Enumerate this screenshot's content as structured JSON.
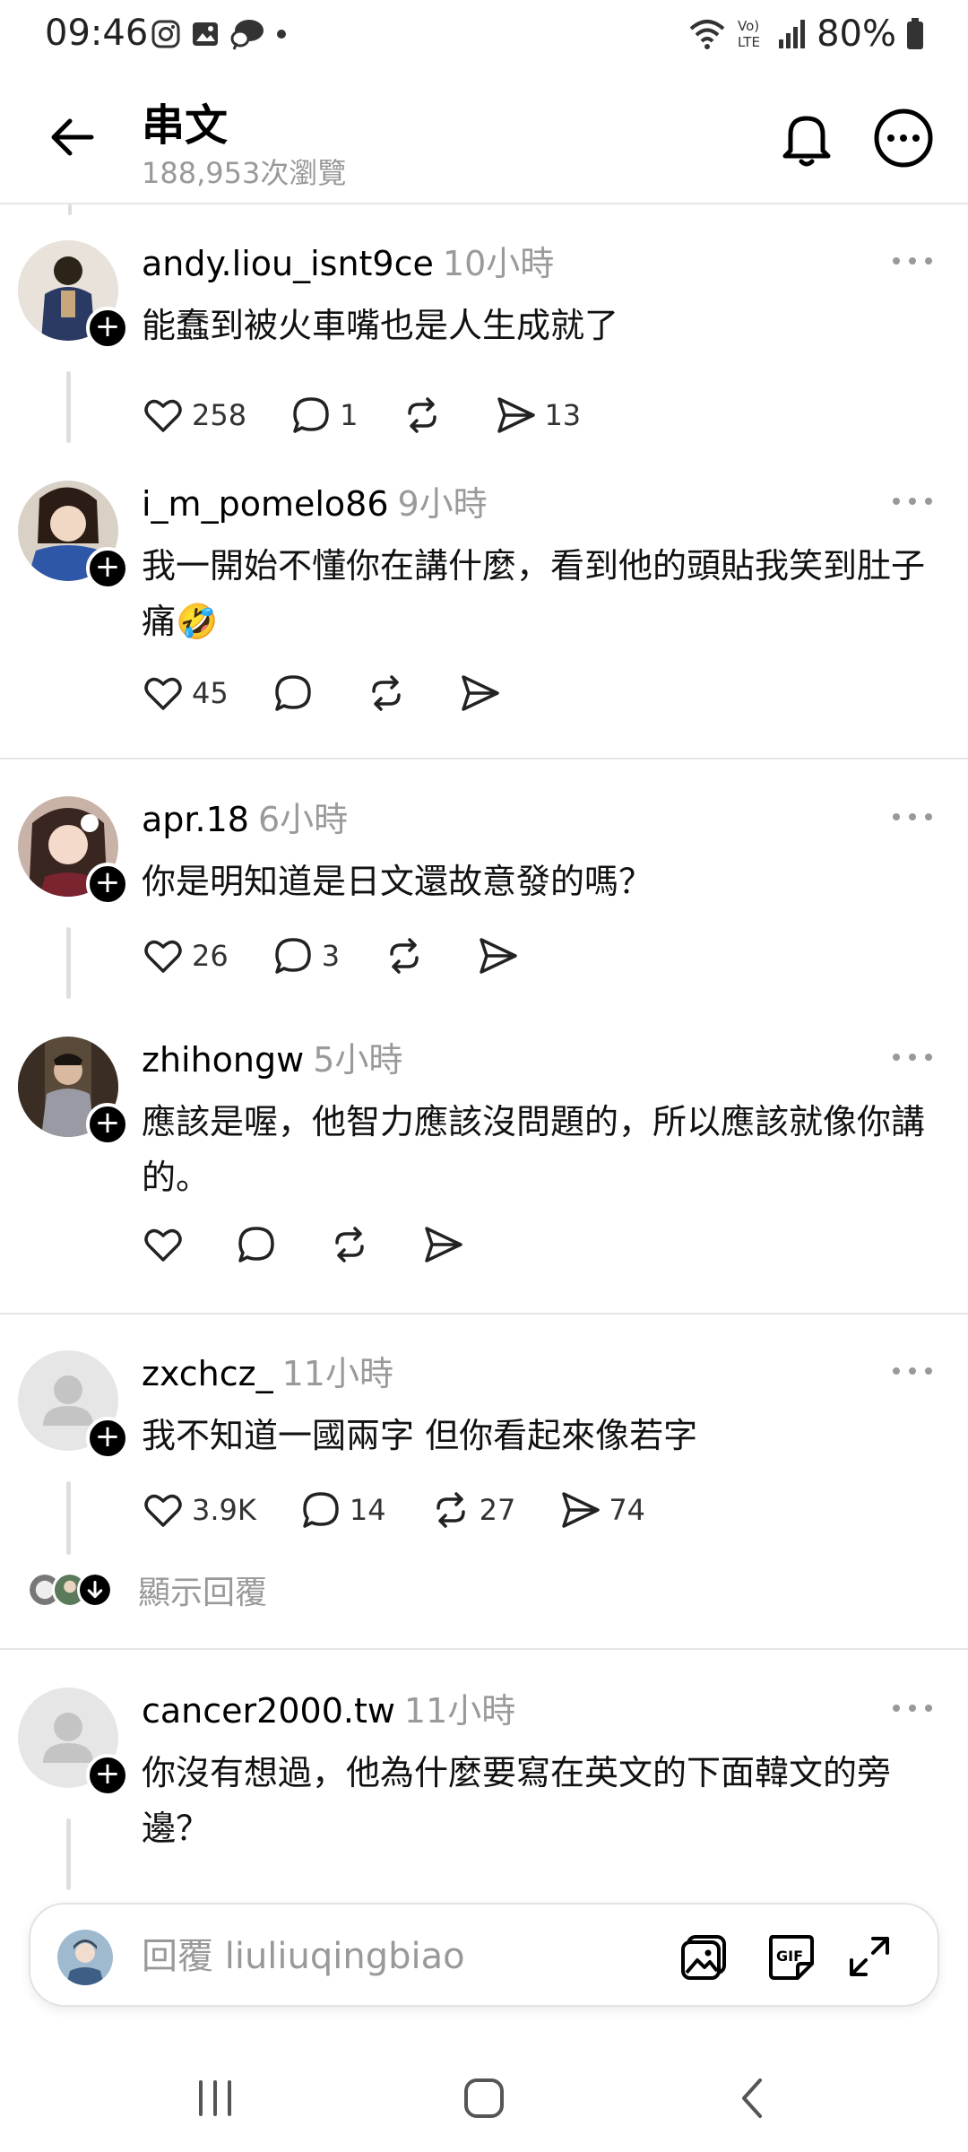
{
  "status_bar": {
    "time": "09:46",
    "battery": "80%",
    "left_icons": [
      "instagram-icon",
      "gallery-icon",
      "chat-icon",
      "dot-icon"
    ],
    "right_icons": [
      "wifi-icon",
      "volte-icon",
      "signal-icon",
      "battery-icon"
    ]
  },
  "header": {
    "title": "串文",
    "views": "188,953次瀏覽"
  },
  "comments": [
    {
      "username": "andy.liou_isnt9ce",
      "time": "10小時",
      "text": "能蠢到被火車嘴也是人生成就了",
      "likes": "258",
      "replies": "1",
      "reposts": "",
      "shares": "13",
      "avatar_color": "#3b4a6b"
    },
    {
      "username": "i_m_pomelo86",
      "time": "9小時",
      "text": "我一開始不懂你在講什麼，看到他的頭貼我笑到肚子痛🤣",
      "likes": "45",
      "replies": "",
      "reposts": "",
      "shares": "",
      "avatar_color": "#2f57a8"
    },
    {
      "username": "apr.18",
      "time": "6小時",
      "text": "你是明知道是日文還故意發的嗎？",
      "likes": "26",
      "replies": "3",
      "reposts": "",
      "shares": "",
      "avatar_color": "#a06a5a"
    },
    {
      "username": "zhihongw",
      "time": "5小時",
      "text": "應該是喔，他智力應該沒問題的，所以應該就像你講的。",
      "likes": "",
      "replies": "",
      "reposts": "",
      "shares": "",
      "avatar_color": "#4a3c30"
    },
    {
      "username": "zxchcz_",
      "time": "11小時",
      "text": "我不知道一國兩字 但你看起來像若字",
      "likes": "3.9K",
      "replies": "14",
      "reposts": "27",
      "shares": "74",
      "avatar_color": "#e6e6e6"
    },
    {
      "username": "cancer2000.tw",
      "time": "11小時",
      "text": "你沒有想過，他為什麼要寫在英文的下面韓文的旁邊？",
      "likes": "",
      "replies": "",
      "reposts": "",
      "shares": "",
      "avatar_color": "#e6e6e6"
    }
  ],
  "show_replies": "顯示回覆",
  "composer": {
    "placeholder": "回覆 liuliuqingbiao",
    "gif_label": "GIF"
  },
  "colors": {
    "secondary_text": "#999999",
    "divider": "#e6e6e6",
    "thread_line": "#dedede"
  }
}
